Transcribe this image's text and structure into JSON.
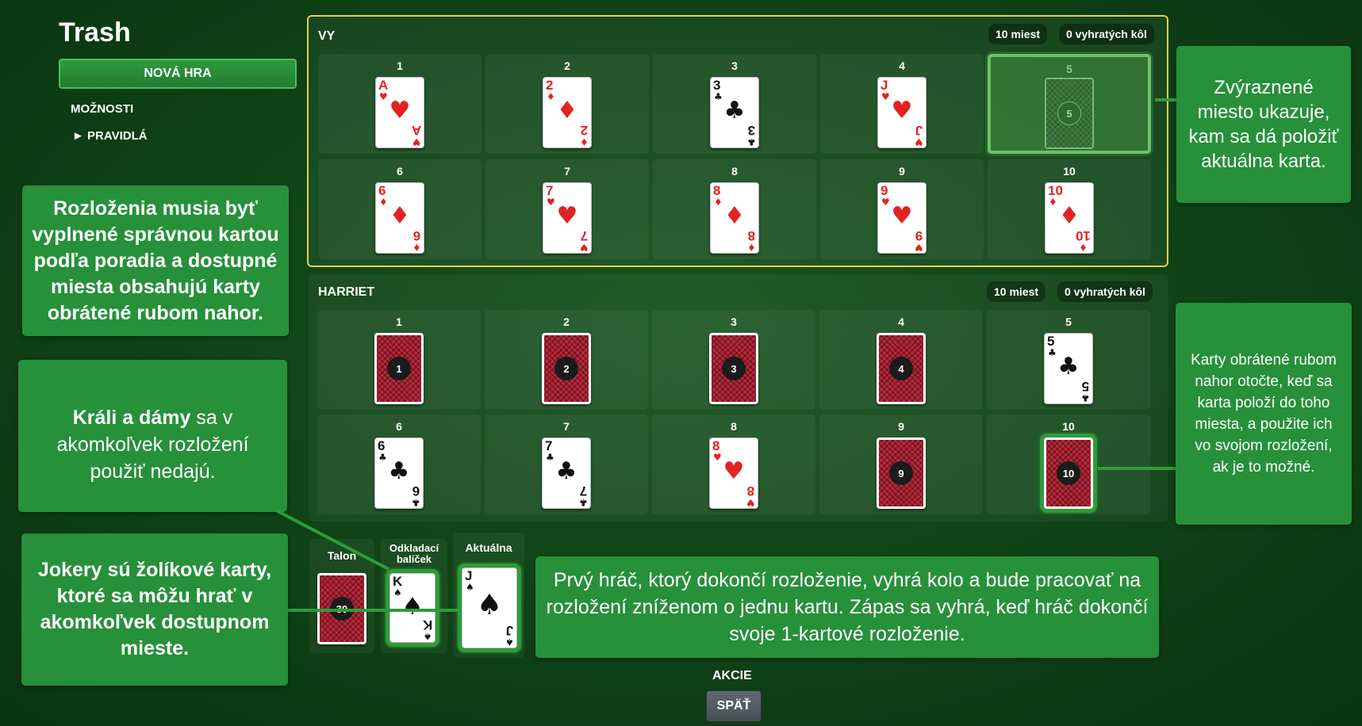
{
  "app": {
    "title": "Trash"
  },
  "sidebar": {
    "new_game": "NOVÁ HRA",
    "options": "MOŽNOSTI",
    "rules": "► PRAVIDLÁ"
  },
  "player": {
    "label": "VY",
    "slots_badge": "10 miest",
    "wins_badge": "0 vyhratých kôl",
    "slots": [
      {
        "num": "1",
        "state": "face-up",
        "rank": "A",
        "suit": "♥",
        "color": "red"
      },
      {
        "num": "2",
        "state": "face-up",
        "rank": "2",
        "suit": "♦",
        "color": "red"
      },
      {
        "num": "3",
        "state": "face-up",
        "rank": "3",
        "suit": "♣",
        "color": "black"
      },
      {
        "num": "4",
        "state": "face-up",
        "rank": "J",
        "suit": "♥",
        "color": "red"
      },
      {
        "num": "5",
        "state": "highlight",
        "back_num": "5"
      },
      {
        "num": "6",
        "state": "face-up",
        "rank": "6",
        "suit": "♦",
        "color": "red"
      },
      {
        "num": "7",
        "state": "face-up",
        "rank": "7",
        "suit": "♥",
        "color": "red"
      },
      {
        "num": "8",
        "state": "face-up",
        "rank": "8",
        "suit": "♦",
        "color": "red"
      },
      {
        "num": "9",
        "state": "face-up",
        "rank": "9",
        "suit": "♥",
        "color": "red"
      },
      {
        "num": "10",
        "state": "face-up",
        "rank": "10",
        "suit": "♦",
        "color": "red"
      }
    ]
  },
  "opponent": {
    "label": "HARRIET",
    "slots_badge": "10 miest",
    "wins_badge": "0 vyhratých kôl",
    "slots": [
      {
        "num": "1",
        "state": "face-down",
        "back_num": "1"
      },
      {
        "num": "2",
        "state": "face-down",
        "back_num": "2"
      },
      {
        "num": "3",
        "state": "face-down",
        "back_num": "3"
      },
      {
        "num": "4",
        "state": "face-down",
        "back_num": "4"
      },
      {
        "num": "5",
        "state": "face-up",
        "rank": "5",
        "suit": "♣",
        "color": "black"
      },
      {
        "num": "6",
        "state": "face-up",
        "rank": "6",
        "suit": "♣",
        "color": "black"
      },
      {
        "num": "7",
        "state": "face-up",
        "rank": "7",
        "suit": "♣",
        "color": "black"
      },
      {
        "num": "8",
        "state": "face-up",
        "rank": "8",
        "suit": "♥",
        "color": "red"
      },
      {
        "num": "9",
        "state": "face-down",
        "back_num": "9"
      },
      {
        "num": "10",
        "state": "face-down-glow",
        "back_num": "10"
      }
    ]
  },
  "piles": {
    "talon_label": "Talon",
    "talon_count": "30",
    "discard_label": "Odkladací balíček",
    "discard_card": {
      "rank": "K",
      "suit": "♠",
      "color": "black"
    },
    "current_label": "Aktuálna",
    "current_card": {
      "rank": "J",
      "suit": "♠",
      "color": "black"
    }
  },
  "callouts": {
    "highlight_hint": "Zvýraznené miesto ukazuje, kam sa dá položiť aktuálna karta.",
    "layout_rule": "Rozloženia musia byť vyplnené správnou kartou podľa poradia a dostupné miesta obsahujú karty obrátené rubom nahor.",
    "kings_queens_bold": "Králi a dámy",
    "kings_queens_rest": " sa v akomkoľvek rozložení použiť nedajú.",
    "jokers": "Jokery sú žolíkové karty, ktoré sa môžu hrať v akomkoľvek dostupnom mieste.",
    "face_down": "Karty obrátené rubom nahor otočte, keď sa karta položí do toho miesta, a použite ich vo svojom rozložení, ak je to možné.",
    "win": "Prvý hráč, ktorý dokončí rozloženie, vyhrá kolo a bude pracovať na rozložení zníženom o jednu kartu. Zápas sa vyhrá, keď hráč dokončí svoje 1-kartové rozloženie."
  },
  "actions": {
    "label": "AKCIE",
    "back": "SPÄŤ"
  },
  "colors": {
    "felt": "#0f4216",
    "callout": "#27903a",
    "active_border": "#e3d24f",
    "card_back": "#c0283b"
  }
}
